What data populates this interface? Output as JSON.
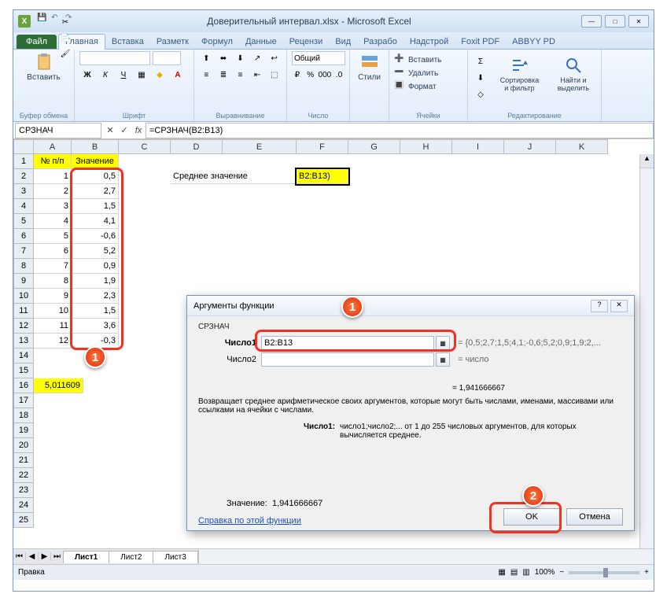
{
  "window": {
    "title": "Доверительный интервал.xlsx - Microsoft Excel"
  },
  "qat": {
    "save": "💾",
    "undo": "↶",
    "redo": "↷"
  },
  "tabs": {
    "file": "Файл",
    "home": "Главная",
    "insert": "Вставка",
    "layout": "Разметк",
    "formulas": "Формул",
    "data": "Данные",
    "review": "Рецензи",
    "view": "Вид",
    "dev": "Разрабо",
    "addins": "Надстрой",
    "foxit": "Foxit PDF",
    "abbyy": "ABBYY PD"
  },
  "groups": {
    "clipboard": "Буфер обмена",
    "font": "Шрифт",
    "align": "Выравнивание",
    "number": "Число",
    "styles": "Стили",
    "cells": "Ячейки",
    "editing": "Редактирование",
    "paste": "Вставить",
    "numfmt": "Общий",
    "insert": "Вставить",
    "delete": "Удалить",
    "format": "Формат",
    "sort": "Сортировка и фильтр",
    "find": "Найти и выделить"
  },
  "formula": {
    "name": "СРЗНАЧ",
    "bar": "=СРЗНАЧ(B2:B13)"
  },
  "cols": [
    "A",
    "B",
    "C",
    "D",
    "E",
    "F",
    "G",
    "H",
    "I",
    "J",
    "K"
  ],
  "rows": [
    "1",
    "2",
    "3",
    "4",
    "5",
    "6",
    "7",
    "8",
    "9",
    "10",
    "11",
    "12",
    "13",
    "14",
    "15",
    "16",
    "17",
    "18",
    "19",
    "20",
    "21",
    "22",
    "23",
    "24",
    "25"
  ],
  "headers": {
    "a": "№ п/п",
    "b": "Значение",
    "mid": "Среднее значение",
    "midval": "B2:B13)"
  },
  "seq": [
    "1",
    "2",
    "3",
    "4",
    "5",
    "6",
    "7",
    "8",
    "9",
    "10",
    "11",
    "12"
  ],
  "vals": [
    "0,5",
    "2,7",
    "1,5",
    "4,1",
    "-0,6",
    "5,2",
    "0,9",
    "1,9",
    "2,3",
    "1,5",
    "3,6",
    "-0,3"
  ],
  "a16": "5,011609",
  "sheets": {
    "s1": "Лист1",
    "s2": "Лист2",
    "s3": "Лист3"
  },
  "status": {
    "mode": "Правка",
    "zoom": "100%",
    "minus": "−",
    "plus": "+"
  },
  "dialog": {
    "title": "Аргументы функции",
    "fname": "СРЗНАЧ",
    "arg1label": "Число1",
    "arg1val": "B2:B13",
    "arg1preview": "= {0,5;2,7;1,5;4,1;-0,6;5,2;0,9;1,9;2,...",
    "arg2label": "Число2",
    "arg2preview": "= число",
    "result_eq": "= 1,941666667",
    "desc": "Возвращает среднее арифметическое своих аргументов, которые могут быть числами, именами, массивами или ссылками на ячейки с числами.",
    "numlabel": "Число1:",
    "numdesc": "число1;число2;... от 1 до 255 числовых аргументов, для которых вычисляется среднее.",
    "value_label": "Значение:",
    "value": "1,941666667",
    "help": "Справка по этой функции",
    "ok": "OK",
    "cancel": "Отмена"
  },
  "callouts": {
    "c1": "1",
    "c2": "1",
    "c3": "2"
  }
}
